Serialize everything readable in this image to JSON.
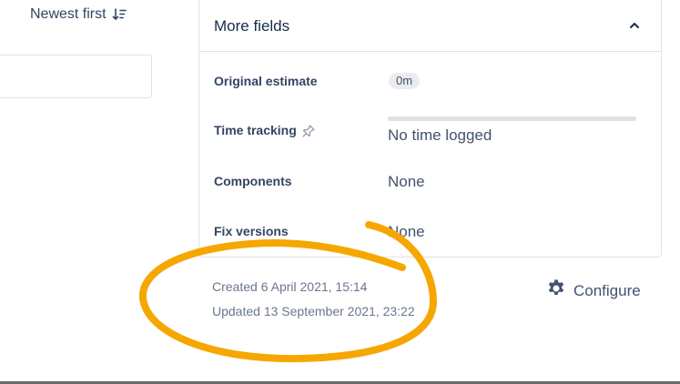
{
  "activity": {
    "sort_label": "Newest first"
  },
  "more_fields": {
    "title": "More fields",
    "fields": [
      {
        "label": "Original estimate",
        "value": "0m"
      },
      {
        "label": "Time tracking",
        "value": "No time logged"
      },
      {
        "label": "Components",
        "value": "None"
      },
      {
        "label": "Fix versions",
        "value": "None"
      }
    ]
  },
  "meta": {
    "created": "Created 6 April 2021, 15:14",
    "updated": "Updated 13 September 2021, 23:22"
  },
  "configure": {
    "label": "Configure"
  },
  "colors": {
    "annotation": "#f5a700",
    "text_primary": "#172b4d",
    "text_secondary": "#42526e",
    "border": "#dfe1e6"
  }
}
